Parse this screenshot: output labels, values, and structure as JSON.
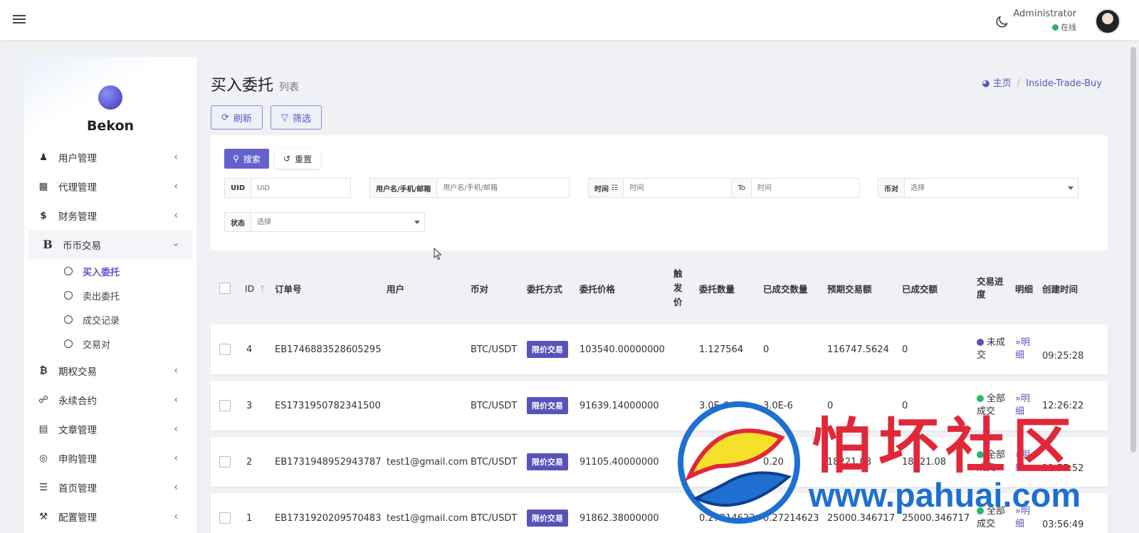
{
  "header": {
    "user_name": "Administrator",
    "status": "在线"
  },
  "sidebar": {
    "brand": "Bekon",
    "items": [
      {
        "label": "用户管理",
        "icon": "user-tie-icon"
      },
      {
        "label": "代理管理",
        "icon": "id-card-icon"
      },
      {
        "label": "财务管理",
        "icon": "dollar-icon"
      },
      {
        "label": "币币交易",
        "icon": "bold-b-icon"
      },
      {
        "label": "期权交易",
        "icon": "bitcoin-icon"
      },
      {
        "label": "永续合约",
        "icon": "link-icon"
      },
      {
        "label": "文章管理",
        "icon": "newspaper-icon"
      },
      {
        "label": "申购管理",
        "icon": "life-ring-icon"
      },
      {
        "label": "首页管理",
        "icon": "list-icon"
      },
      {
        "label": "配置管理",
        "icon": "wrench-icon"
      }
    ],
    "subitems": [
      "买入委托",
      "卖出委托",
      "成交记录",
      "交易对"
    ]
  },
  "page": {
    "title": "买入委托",
    "subtitle": "列表",
    "breadcrumb_home": "主页",
    "breadcrumb_current": "Inside-Trade-Buy",
    "refresh": "刷新",
    "filter": "筛选"
  },
  "filters": {
    "search": "搜索",
    "reset": "重置",
    "uid_label": "UID",
    "uid_placeholder": "UID",
    "user_label": "用户名/手机/邮箱",
    "user_placeholder": "用户名/手机/邮箱",
    "time_label": "时间",
    "time_placeholder": "时间",
    "to_label": "To",
    "to_placeholder": "时间",
    "pair_label": "币对",
    "pair_placeholder": "选择",
    "status_label": "状态",
    "status_placeholder": "选择"
  },
  "table": {
    "headers": {
      "id": "ID",
      "order_no": "订单号",
      "user": "用户",
      "pair": "币对",
      "method": "委托方式",
      "price": "委托价格",
      "trigger": "触发价",
      "qty": "委托数量",
      "filled_qty": "已成交数量",
      "expected": "预期交易额",
      "filled_amt": "已成交额",
      "progress": "交易进度",
      "detail": "明细",
      "created": "创建时间"
    },
    "rows": [
      {
        "id": "4",
        "order_no": "EB1746883528605295",
        "user": "",
        "pair": "BTC/USDT",
        "method": "限价交易",
        "price": "103540.00000000",
        "qty": "1.127564",
        "filled_qty": "0",
        "expected": "116747.5624",
        "filled_amt": "0",
        "progress": "未成交",
        "progress_color": "#5753b9",
        "detail": "»明细",
        "created": "09:25:28"
      },
      {
        "id": "3",
        "order_no": "ES1731950782341500",
        "user": "",
        "pair": "BTC/USDT",
        "method": "限价交易",
        "price": "91639.14000000",
        "qty": "3.0E-6",
        "filled_qty": "3.0E-6",
        "expected": "0",
        "filled_amt": "0",
        "progress": "全部成交",
        "progress_color": "#28b76b",
        "detail": "»明细",
        "created": "12:26:22"
      },
      {
        "id": "2",
        "order_no": "EB1731948952943787",
        "user": "test1@gmail.com",
        "pair": "BTC/USDT",
        "method": "限价交易",
        "price": "91105.40000000",
        "qty": "0.20",
        "filled_qty": "0.20",
        "expected": "18221.08",
        "filled_amt": "18221.08",
        "progress": "全部成交",
        "progress_color": "#28b76b",
        "detail": "»明细",
        "created": "11:55:52"
      },
      {
        "id": "1",
        "order_no": "EB1731920209570483",
        "user": "test1@gmail.com",
        "pair": "BTC/USDT",
        "method": "限价交易",
        "price": "91862.38000000",
        "qty": "0.27214623",
        "filled_qty": "0.27214623",
        "expected": "25000.346717",
        "filled_amt": "25000.346717",
        "progress": "全部成交",
        "progress_color": "#28b76b",
        "detail": "»明细",
        "created": "03:56:49"
      }
    ]
  },
  "watermark": {
    "text": "怕坏社区",
    "url": "www.pahuai.com"
  }
}
